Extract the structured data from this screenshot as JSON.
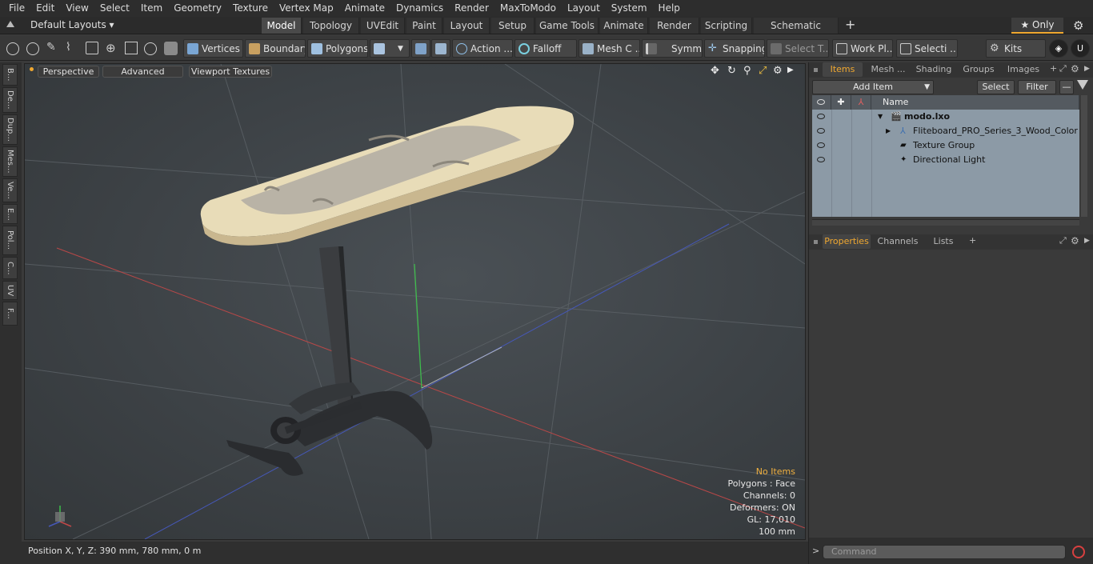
{
  "menu": [
    "File",
    "Edit",
    "View",
    "Select",
    "Item",
    "Geometry",
    "Texture",
    "Vertex Map",
    "Animate",
    "Dynamics",
    "Render",
    "MaxToModo",
    "Layout",
    "System",
    "Help"
  ],
  "layout_selector": "Default Layouts ▾",
  "layout_tabs": [
    "Model",
    "Topology",
    "UVEdit",
    "Paint",
    "Layout",
    "Setup",
    "Game Tools",
    "Animate",
    "Render",
    "Scripting",
    "Schematic Fusion"
  ],
  "layout_add": "+",
  "only_label": "★ Only",
  "toolbar": {
    "vertices": "Vertices",
    "boundary": "Boundary",
    "polygons": "Polygons",
    "action": "Action ...",
    "falloff": "Falloff",
    "mesh_c": "Mesh C ...",
    "symm": "Symm ...",
    "snapping": "Snapping",
    "select_t": "Select T...",
    "work_pl": "Work Pl...",
    "selecti": "Selecti ...",
    "kits": "Kits"
  },
  "left_tools": [
    "B...",
    "De...",
    "Dup...",
    "Mes...",
    "Ve...",
    "E...",
    "Pol...",
    "C...",
    "UV",
    "F..."
  ],
  "viewport": {
    "tabs": [
      "Perspective",
      "Advanced",
      "Viewport Textures"
    ],
    "info": {
      "no_items": "No Items",
      "polygons": "Polygons : Face",
      "channels": "Channels: 0",
      "deformers": "Deformers: ON",
      "gl": "GL: 17,010",
      "scale": "100 mm"
    }
  },
  "status": "Position X, Y, Z:   390 mm, 780 mm, 0 m",
  "items_panel": {
    "tabs": [
      "Items",
      "Mesh ...",
      "Shading",
      "Groups",
      "Images"
    ],
    "add_item": "Add Item",
    "select": "Select",
    "filter": "Filter",
    "name_header": "Name",
    "rows": [
      "modo.lxo",
      "Fliteboard_PRO_Series_3_Wood_Color",
      "Texture Group",
      "Directional Light"
    ]
  },
  "properties_panel": {
    "tabs": [
      "Properties",
      "Channels",
      "Lists"
    ]
  },
  "command_placeholder": "Command",
  "colors": {
    "accent": "#f0a830",
    "list_bg": "#8c9aa6",
    "viewport_bg": "#3d4246"
  }
}
